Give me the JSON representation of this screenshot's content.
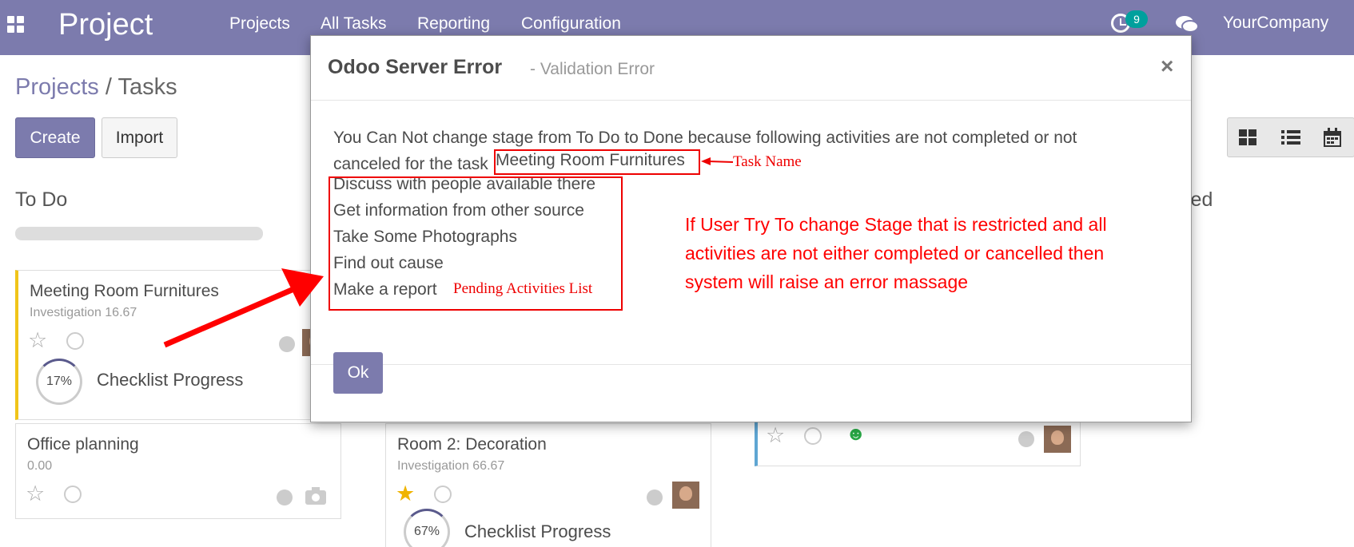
{
  "navbar": {
    "brand": "Project",
    "menu": [
      "Projects",
      "All Tasks",
      "Reporting",
      "Configuration"
    ],
    "activity_count": "9",
    "company": "YourCompany"
  },
  "page": {
    "breadcrumb": {
      "parent": "Projects",
      "separator": "/",
      "current": "Tasks"
    },
    "buttons": {
      "create": "Create",
      "import": "Import"
    },
    "columns": [
      {
        "title": "To Do"
      },
      {
        "title": "led"
      }
    ],
    "cards": [
      {
        "title": "Meeting Room Furnitures",
        "sub": "Investigation 16.67",
        "progress": "17%",
        "progress_label": "Checklist Progress"
      },
      {
        "title": "Office planning",
        "sub": "0.00"
      },
      {
        "title": "Room 2: Decoration",
        "sub": "Investigation 66.67",
        "progress": "67%",
        "progress_label": "Checklist Progress"
      }
    ]
  },
  "modal": {
    "title": "Odoo Server Error",
    "subtitle": "- Validation Error",
    "close": "×",
    "message_line1": "You Can Not change stage from To Do to Done because following activities are not completed or not",
    "message_line2": "canceled for the task",
    "task_name": "Meeting Room Furnitures",
    "activities": [
      "Discuss with people available there",
      "Get information from other source",
      "Take Some Photographs",
      "Find out cause",
      "Make a report"
    ],
    "ok": "Ok"
  },
  "annotations": {
    "task_name_label": "Task Name",
    "pending_label": "Pending Activities List",
    "explanation": "If User Try To change Stage that is restricted and all activities are not either completed or cancelled then system will raise an error  massage",
    "color": "#ff0000"
  }
}
